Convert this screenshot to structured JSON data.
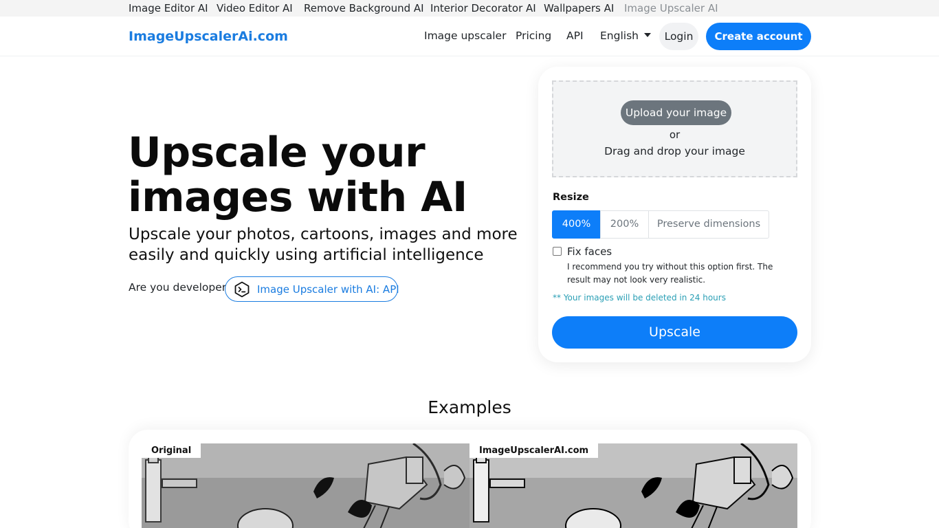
{
  "topbar": {
    "links": [
      "Image Editor AI",
      "Video Editor AI",
      "Remove Background AI",
      "Interior Decorator AI",
      "Wallpapers AI",
      "Image Upscaler AI"
    ]
  },
  "nav": {
    "brand": "ImageUpscalerAi.com",
    "links": [
      "Image upscaler",
      "Pricing",
      "API"
    ],
    "language": "English",
    "login": "Login",
    "create_account": "Create account"
  },
  "hero": {
    "title_line1": "Upscale your",
    "title_line2": "images with AI",
    "subtitle_line1": "Upscale your photos, cartoons, images and more",
    "subtitle_line2": "easily and quickly using artificial intelligence",
    "developer_prompt": "Are you developer?",
    "api_link": "Image Upscaler with AI: API"
  },
  "uploader": {
    "upload_button": "Upload your image",
    "or": "or",
    "drag_text": "Drag and drop your image",
    "resize_label": "Resize",
    "resize_options": [
      "400%",
      "200%",
      "Preserve dimensions"
    ],
    "resize_selected": "400%",
    "fix_faces_label": "Fix faces",
    "fix_faces_checked": false,
    "fix_faces_note": "I recommend you try without this option first. The result may not look very realistic.",
    "deletion_note": "** Your images will be deleted in 24 hours",
    "upscale_button": "Upscale"
  },
  "examples": {
    "title": "Examples",
    "original_label": "Original",
    "upscaled_label": "ImageUpscalerAI.com"
  },
  "colors": {
    "brand_blue": "#1a7ce0",
    "primary_button": "#0d7ef9",
    "secondary_button": "#6c757d",
    "note_teal": "#2a9fb5"
  }
}
